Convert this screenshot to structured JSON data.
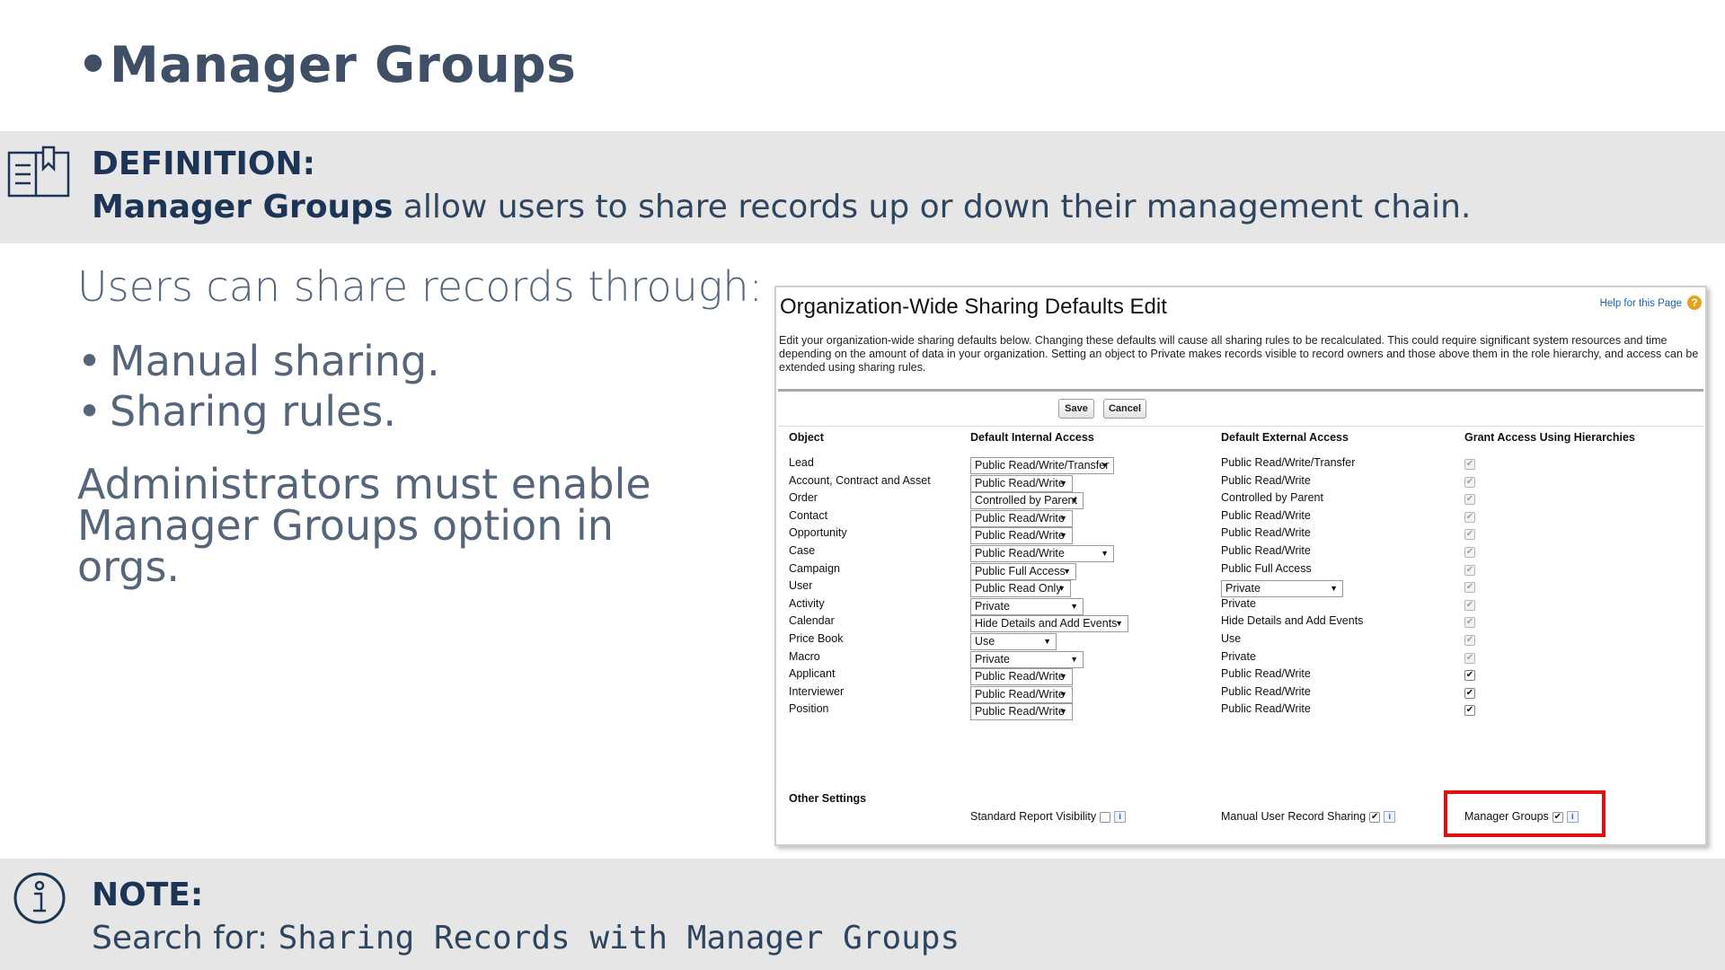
{
  "slide": {
    "title": "Manager Groups",
    "bullet": "•"
  },
  "definition": {
    "icon": "book-icon",
    "heading": "DEFINITION:",
    "term": "Manager Groups",
    "text": " allow users to share records up or down their management chain."
  },
  "body": {
    "intro": "Users can share records through:",
    "bullets": [
      "Manual sharing.",
      "Sharing rules."
    ],
    "admin": "Administrators must enable Manager Groups option in orgs."
  },
  "screenshot": {
    "title": "Organization-Wide Sharing Defaults Edit",
    "help_link": "Help for this Page",
    "help_icon": "?",
    "description": "Edit your organization-wide sharing defaults below. Changing these defaults will cause all sharing rules to be recalculated. This could require significant system resources and time depending on the amount of data in your organization. Setting an object to Private makes records visible to record owners and those above them in the role hierarchy, and access can be extended using sharing rules.",
    "save_label": "Save",
    "cancel_label": "Cancel",
    "columns": [
      "Object",
      "Default Internal Access",
      "Default External Access",
      "Grant Access Using Hierarchies"
    ],
    "rows": [
      {
        "object": "Lead",
        "internal": "Public Read/Write/Transfer",
        "external": "Public Read/Write/Transfer",
        "grant": "✔"
      },
      {
        "object": "Account, Contract and Asset",
        "internal": "Public Read/Write",
        "external": "Public Read/Write",
        "grant": "✔"
      },
      {
        "object": "Order",
        "internal": "Controlled by Parent",
        "external": "Controlled by Parent",
        "grant": "✔"
      },
      {
        "object": "Contact",
        "internal": "Public Read/Write",
        "external": "Public Read/Write",
        "grant": "✔"
      },
      {
        "object": "Opportunity",
        "internal": "Public Read/Write",
        "external": "Public Read/Write",
        "grant": "✔"
      },
      {
        "object": "Case",
        "internal": "Public Read/Write",
        "external": "Public Read/Write",
        "grant": "✔"
      },
      {
        "object": "Campaign",
        "internal": "Public Full Access",
        "external": "Public Full Access",
        "grant": "✔"
      },
      {
        "object": "User",
        "internal": "Public Read Only",
        "external": "Private",
        "grant": "✔"
      },
      {
        "object": "Activity",
        "internal": "Private",
        "external": "Private",
        "grant": "✔"
      },
      {
        "object": "Calendar",
        "internal": "Hide Details and Add Events",
        "external": "Hide Details and Add Events",
        "grant": "✔"
      },
      {
        "object": "Price Book",
        "internal": "Use",
        "external": "Use",
        "grant": "✔"
      },
      {
        "object": "Macro",
        "internal": "Private",
        "external": "Private",
        "grant": "✔"
      },
      {
        "object": "Applicant",
        "internal": "Public Read/Write",
        "external": "Public Read/Write",
        "grant": "✔"
      },
      {
        "object": "Interviewer",
        "internal": "Public Read/Write",
        "external": "Public Read/Write",
        "grant": "✔"
      },
      {
        "object": "Position",
        "internal": "Public Read/Write",
        "external": "Public Read/Write",
        "grant": "✔"
      }
    ],
    "dropdown_arrow": "▼",
    "other_settings": {
      "heading": "Other Settings",
      "standard_report": "Standard Report Visibility",
      "manual_user": "Manual User Record Sharing",
      "manager_groups": "Manager Groups",
      "check": "✔",
      "info": "i"
    }
  },
  "note": {
    "icon": "info-icon",
    "heading": "NOTE:",
    "prefix": "Search for: ",
    "search_term": "Sharing Records with Manager Groups"
  },
  "colors": {
    "title": "#3e4f66",
    "heading": "#1c3556",
    "band": "#e6e6e6",
    "highlight": "#e11010"
  }
}
